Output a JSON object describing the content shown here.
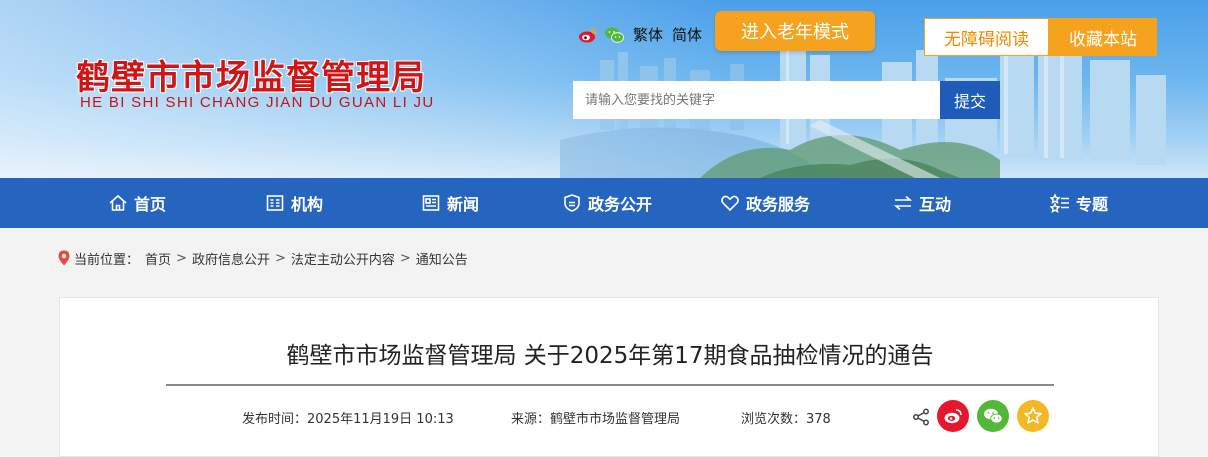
{
  "header": {
    "site_title": "鹤壁市市场监督管理局",
    "site_pinyin": "HE BI SHI SHI CHANG JIAN DU GUAN LI JU",
    "lang_traditional": "繁体",
    "lang_simplified": "简体",
    "elder_mode_label": "进入老年模式",
    "accessibility_label": "无障碍阅读",
    "favorite_label": "收藏本站",
    "search_placeholder": "请输入您要找的关键字",
    "search_button_label": "提交"
  },
  "nav": {
    "items": [
      {
        "label": "首页",
        "icon": "home-icon"
      },
      {
        "label": "机构",
        "icon": "org-icon"
      },
      {
        "label": "新闻",
        "icon": "news-icon"
      },
      {
        "label": "政务公开",
        "icon": "shield-doc-icon"
      },
      {
        "label": "政务服务",
        "icon": "heart-icon"
      },
      {
        "label": "互动",
        "icon": "exchange-icon"
      },
      {
        "label": "专题",
        "icon": "star-list-icon"
      }
    ]
  },
  "breadcrumb": {
    "prefix": "当前位置：",
    "items": [
      "首页",
      "政府信息公开",
      "法定主动公开内容",
      "通知公告"
    ],
    "separator": ">"
  },
  "article": {
    "title": "鹤壁市市场监督管理局 关于2025年第17期食品抽检情况的通告",
    "publish_time": "发布时间：2025年11月19日 10:13",
    "source": "来源：鹤壁市市场监督管理局",
    "views": "浏览次数：378"
  },
  "colors": {
    "nav_blue": "#2564bf",
    "accent_orange": "#f5a31e",
    "title_red": "#cf1515",
    "weibo_red": "#e6162d",
    "wechat_green": "#52b837",
    "qzone_yellow": "#f4b824"
  }
}
